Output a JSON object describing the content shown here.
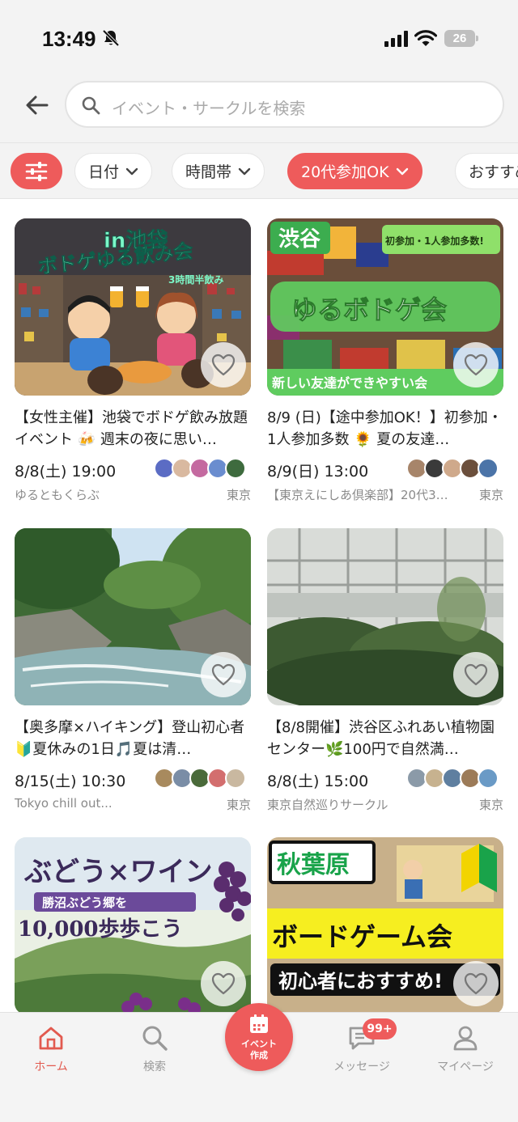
{
  "status": {
    "time": "13:49",
    "battery": "26"
  },
  "search": {
    "placeholder": "イベント・サークルを検索"
  },
  "filters": {
    "date": "日付",
    "time_slot": "時間帯",
    "age": "20代参加OK",
    "sort": "おすすめ順"
  },
  "colors": {
    "accent": "#ee5b5b",
    "tab_active": "#e25a4f"
  },
  "events": [
    {
      "image_text": {
        "line1": "in池袋",
        "line2": "ボドゲゆる飲み会",
        "line3": "3時間半飲み"
      },
      "title": "【女性主催】池袋でボドゲ飲み放題イベント 🍻 週末の夜に思い…",
      "date": "8/8(土) 19:00",
      "organizer": "ゆるともくらぶ",
      "location": "東京"
    },
    {
      "image_text": {
        "line1": "渋谷",
        "line2": "初参加・1人参加多数!",
        "line3": "ゆるボドゲ会",
        "line4": "新しい友達ができやすい会"
      },
      "title": "8/9 (日)【途中参加OK！】初参加・1人参加多数 🌻 夏の友達…",
      "date": "8/9(日) 13:00",
      "organizer": "【東京えにしあ倶楽部】20代3…",
      "location": "東京"
    },
    {
      "title": "【奥多摩×ハイキング】登山初心者🔰夏休みの1日🎵夏は清…",
      "date": "8/15(土) 10:30",
      "organizer": "Tokyo chill out...",
      "location": "東京"
    },
    {
      "title": "【8/8開催】渋谷区ふれあい植物園センター🌿100円で自然満…",
      "date": "8/8(土) 15:00",
      "organizer": "東京自然巡りサークル",
      "location": "東京"
    },
    {
      "image_text": {
        "line1": "ぶどう×ワイン",
        "line2": "勝沼ぶどう郷を",
        "line3": "10,000歩歩こう"
      }
    },
    {
      "image_text": {
        "line1": "秋葉原",
        "line2": "ボードゲーム会",
        "line3": "初心者におすすめ!"
      }
    }
  ],
  "nav": {
    "home": "ホーム",
    "search": "検索",
    "create_line1": "イベント",
    "create_line2": "作成",
    "messages": "メッセージ",
    "messages_badge": "99+",
    "mypage": "マイページ"
  }
}
